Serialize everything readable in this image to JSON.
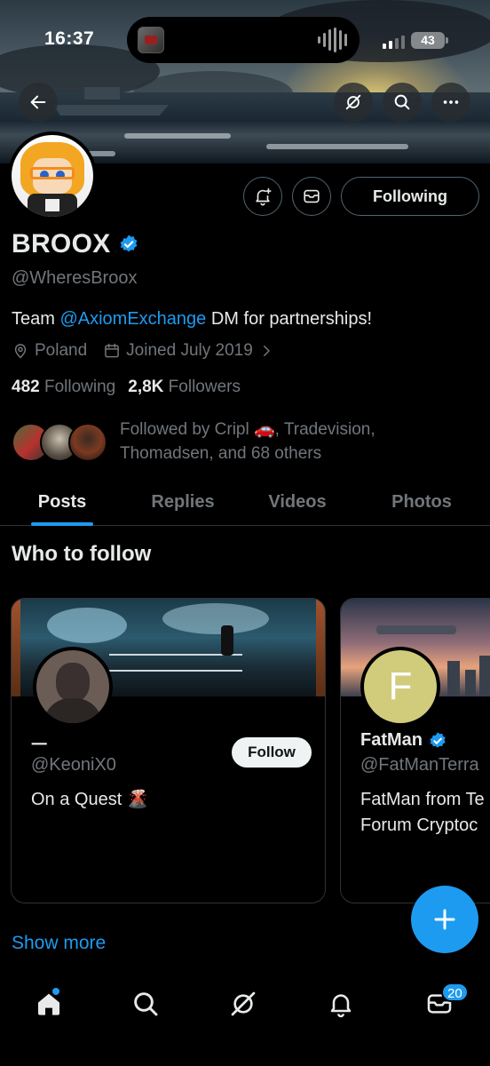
{
  "status_bar": {
    "time": "16:37",
    "battery": "43"
  },
  "profile": {
    "name": "BROOX",
    "handle": "@WheresBroox",
    "bio_prefix": "Team ",
    "bio_mention": "@AxiomExchange",
    "bio_suffix": " DM for partnerships!",
    "location": "Poland",
    "joined": "Joined July 2019",
    "following_count": "482",
    "following_label": "Following",
    "followers_count": "2,8K",
    "followers_label": "Followers",
    "followed_by_text": "Followed by Cripl 🚗, Tradevision, Thomadsen, and 68 others",
    "following_button": "Following"
  },
  "tabs": [
    {
      "label": "Posts",
      "active": true
    },
    {
      "label": "Replies",
      "active": false
    },
    {
      "label": "Videos",
      "active": false
    },
    {
      "label": "Photos",
      "active": false
    }
  ],
  "who_to_follow": {
    "title": "Who to follow",
    "cards": [
      {
        "name": "ㅡ",
        "handle": "@KeoniX0",
        "bio": "On a Quest 🌋",
        "follow_label": "Follow"
      },
      {
        "name": "FatMan",
        "handle": "@FatManTerra",
        "bio_line1": "FatMan from Te",
        "bio_line2": "Forum Cryptoc",
        "avatar_letter": "F"
      }
    ],
    "show_more": "Show more"
  },
  "nav": {
    "messages_badge": "20"
  },
  "icons": {
    "back": "arrow-left-icon",
    "grok": "grok-icon",
    "search": "search-icon",
    "more": "more-icon",
    "notify": "bell-plus-icon",
    "message": "envelope-icon",
    "location": "map-pin-icon",
    "calendar": "calendar-icon",
    "compose": "plus-icon"
  },
  "colors": {
    "accent": "#1d9bf0",
    "background": "#000000",
    "muted": "#71767b"
  }
}
